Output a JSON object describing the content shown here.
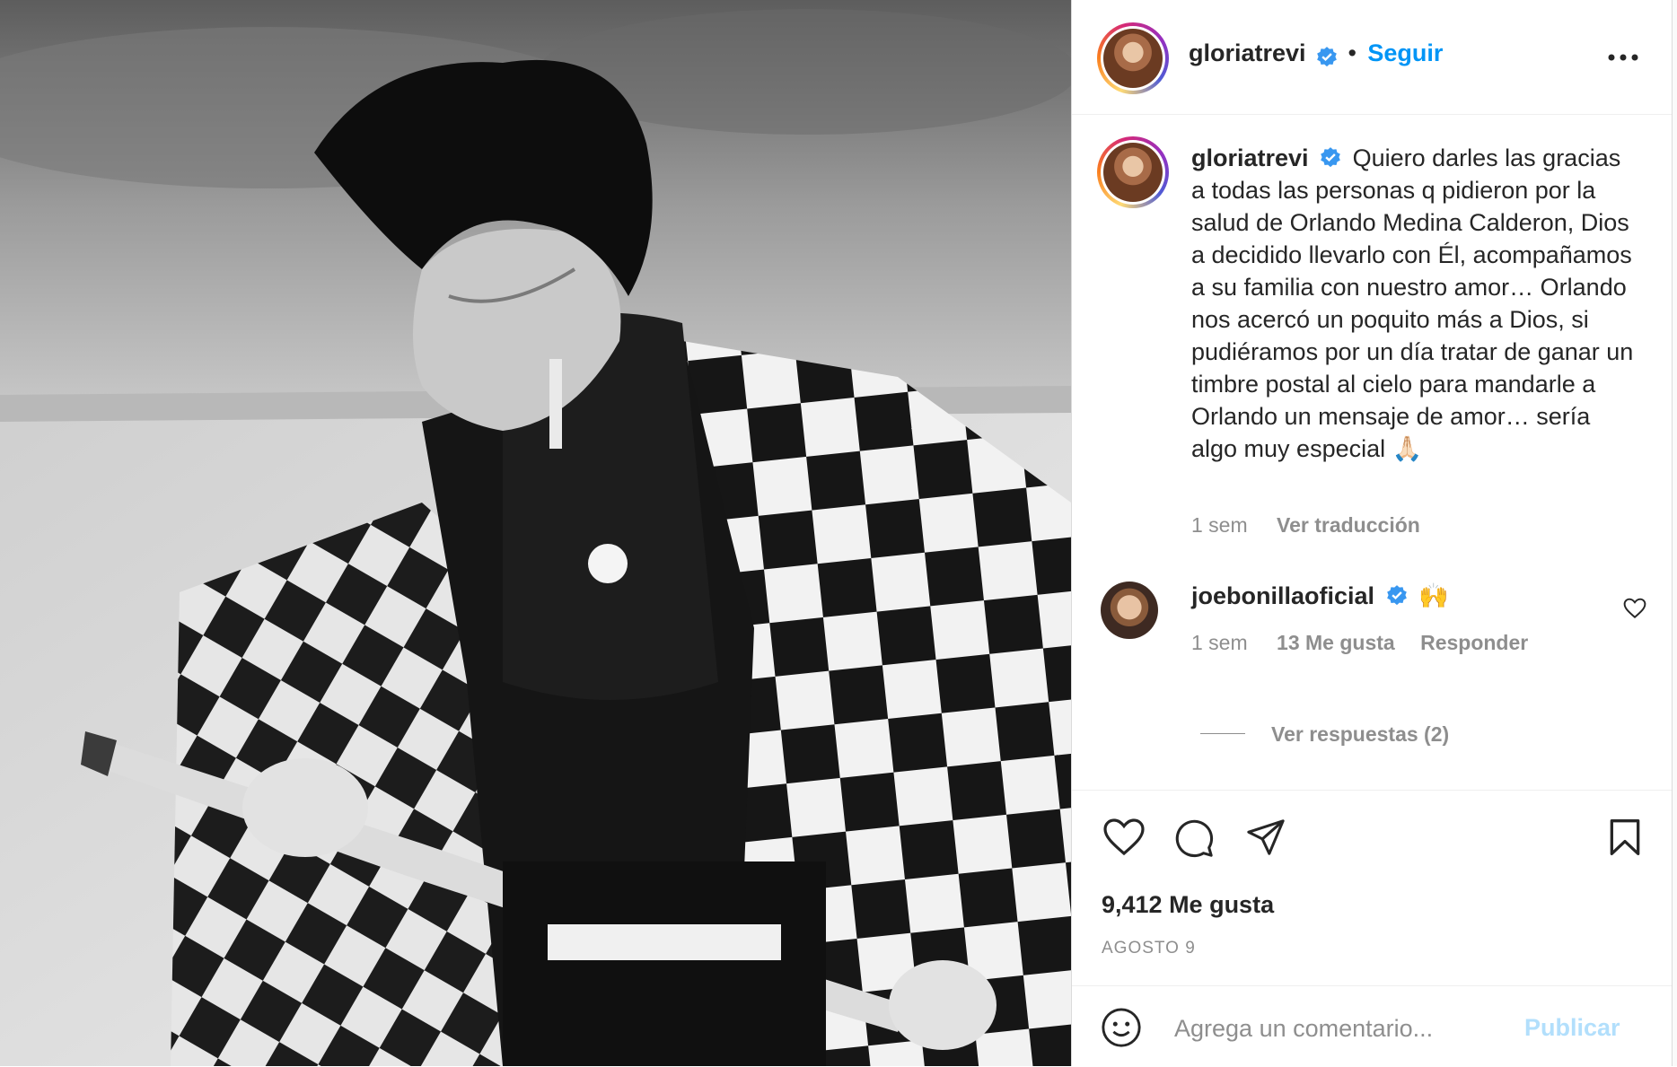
{
  "post": {
    "author": "gloriatrevi",
    "follow_label": "Seguir",
    "separator": "•",
    "more_label": "...",
    "caption": "Quiero darles las gracias a todas las personas q pidieron por la salud de Orlando Medina Calderon, Dios a decidido llevarlo con Él, acompañamos a su familia con nuestro amor… Orlando nos acercó un poquito más a Dios, si pudiéramos por un día tratar de ganar un timbre postal al cielo para mandarle a Orlando un mensaje de amor… sería algo muy especial 🙏🏻",
    "caption_time": "1 sem",
    "translate_label": "Ver traducción",
    "likes": "9,412 Me gusta",
    "date": "AGOSTO 9"
  },
  "comments": [
    {
      "author": "joebonillaoficial",
      "text": "🙌",
      "time": "1 sem",
      "likes": "13 Me gusta",
      "reply_label": "Responder",
      "view_replies": "Ver respuestas (2)"
    }
  ],
  "comment_box": {
    "placeholder": "Agrega un comentario...",
    "publish_label": "Publicar"
  },
  "colors": {
    "link_blue": "#0095f6",
    "publish_disabled": "#b2dffc",
    "muted": "#8e8e8e",
    "verified": "#3897f0"
  },
  "icons": [
    "verified-badge-icon",
    "more-options-icon",
    "heart-icon",
    "comment-icon",
    "share-icon",
    "bookmark-icon",
    "emoji-icon",
    "small-heart-icon"
  ]
}
